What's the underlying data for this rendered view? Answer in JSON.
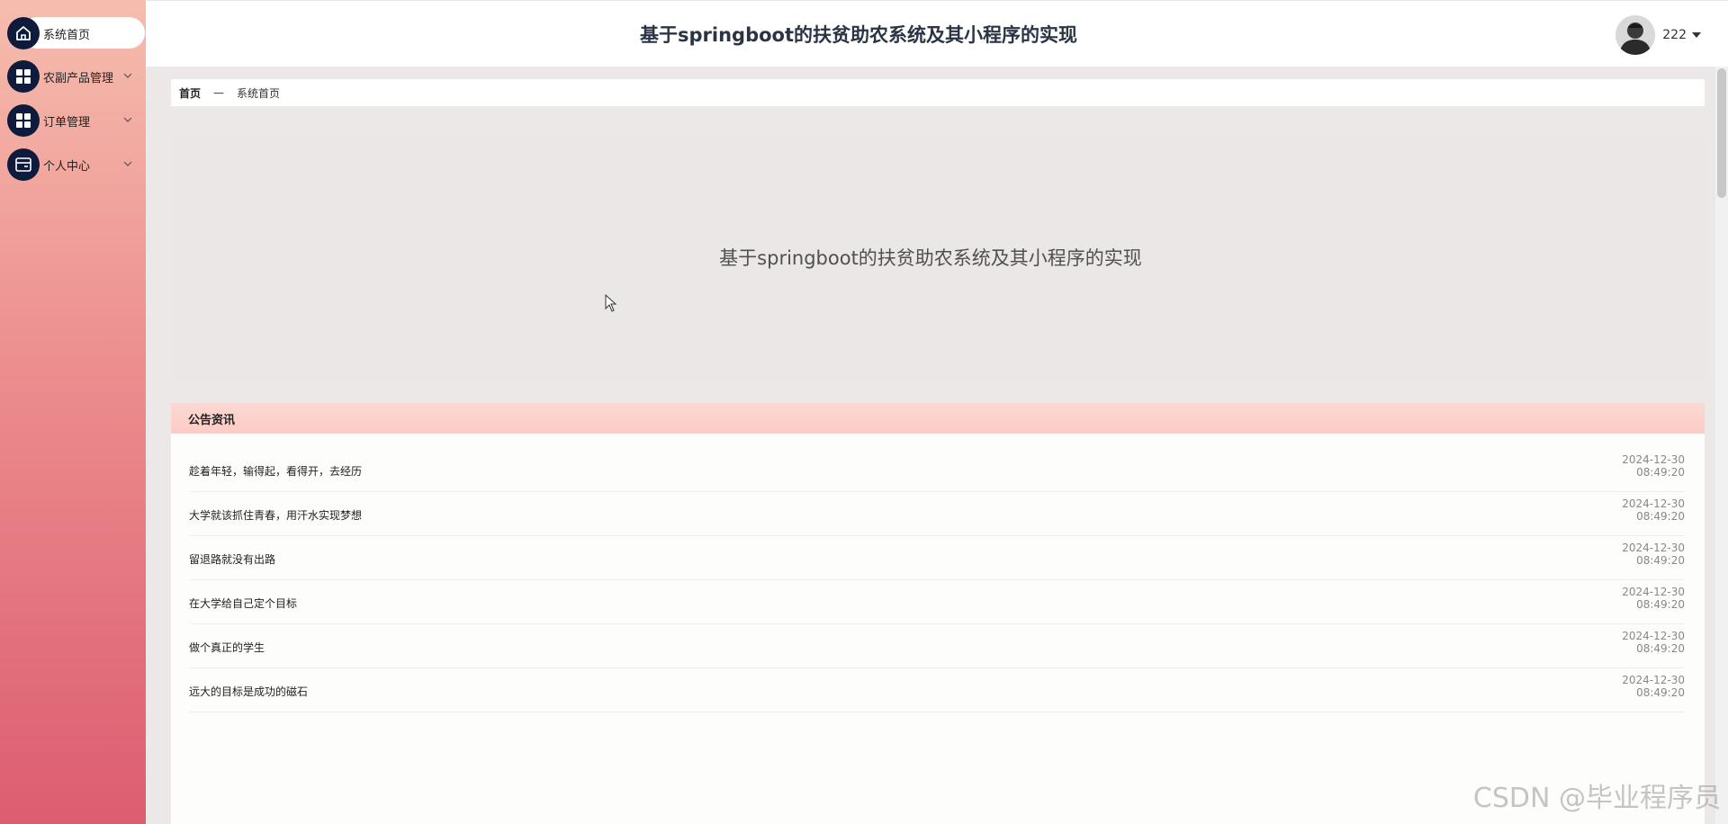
{
  "sidebar": {
    "items": [
      {
        "label": "系统首页",
        "icon": "home-icon",
        "active": true
      },
      {
        "label": "农副产品管理",
        "icon": "grid-icon"
      },
      {
        "label": "订单管理",
        "icon": "grid-icon"
      },
      {
        "label": "个人中心",
        "icon": "card-icon"
      }
    ]
  },
  "header": {
    "title": "基于springboot的扶贫助农系统及其小程序的实现",
    "username": "222"
  },
  "breadcrumb": {
    "home": "首页",
    "separator": "—",
    "current": "系统首页"
  },
  "banner": {
    "title": "基于springboot的扶贫助农系统及其小程序的实现"
  },
  "notices": {
    "title": "公告资讯",
    "items": [
      {
        "title": "趁着年轻，输得起，看得开，去经历",
        "date": "2024-12-30",
        "time": "08:49:20"
      },
      {
        "title": "大学就该抓住青春，用汗水实现梦想",
        "date": "2024-12-30",
        "time": "08:49:20"
      },
      {
        "title": "留退路就没有出路",
        "date": "2024-12-30",
        "time": "08:49:20"
      },
      {
        "title": "在大学给自己定个目标",
        "date": "2024-12-30",
        "time": "08:49:20"
      },
      {
        "title": "做个真正的学生",
        "date": "2024-12-30",
        "time": "08:49:20"
      },
      {
        "title": "远大的目标是成功的磁石",
        "date": "2024-12-30",
        "time": "08:49:20"
      }
    ]
  },
  "watermark": "CSDN @毕业程序员",
  "colors": {
    "nav_icon_bg": "#0f1b3d",
    "sidebar_top": "#f6bdae",
    "sidebar_bottom": "#dc5d70",
    "notices_header": "#fecbc6"
  }
}
